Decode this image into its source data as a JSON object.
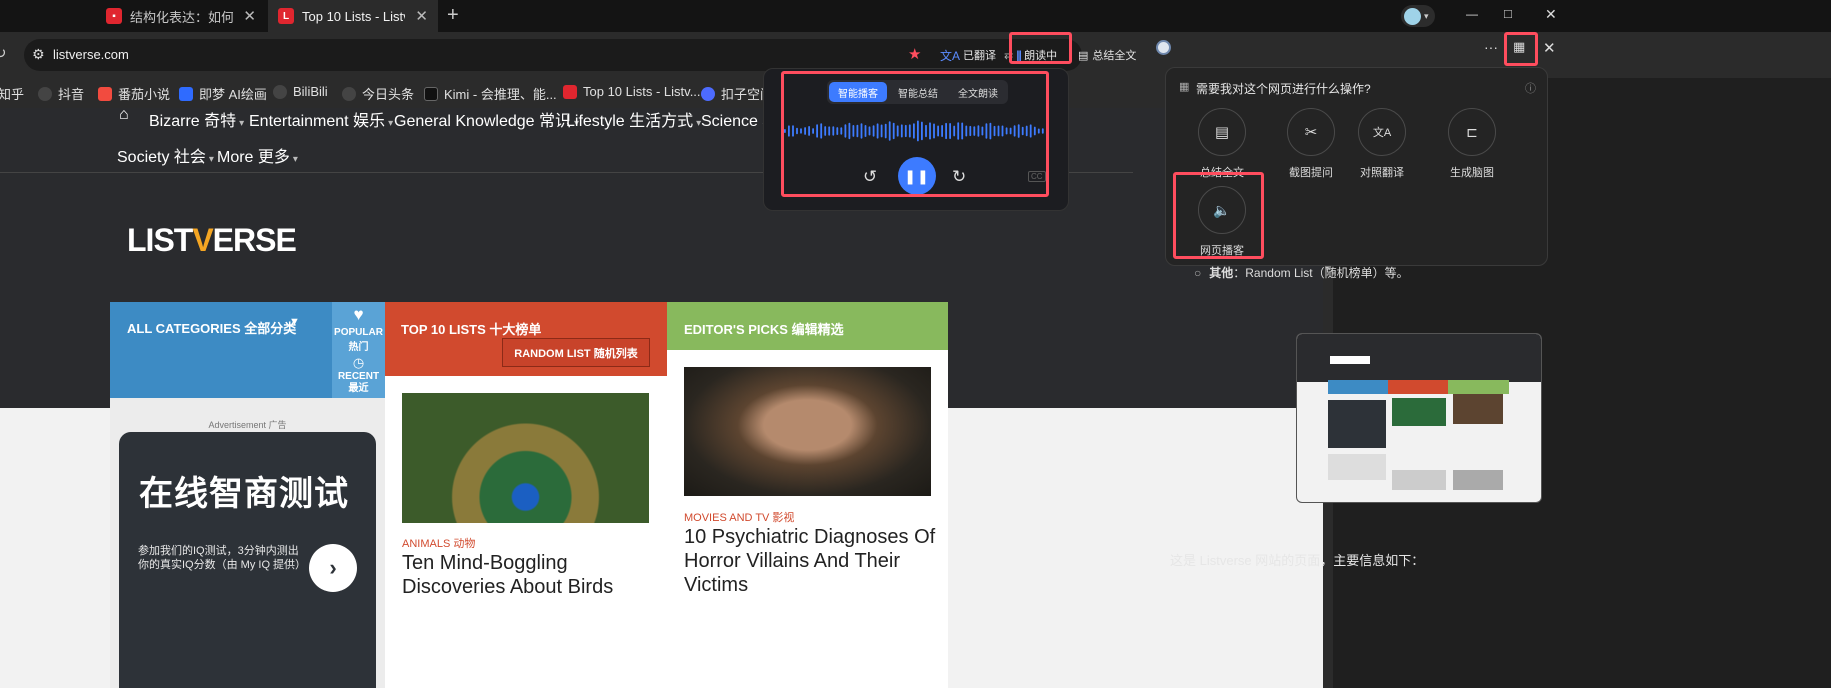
{
  "tabs": [
    {
      "title": "结构化表达：如何汇报工作",
      "active": false,
      "favicon_color": "#e0262f"
    },
    {
      "title": "Top 10 Lists - Listverse",
      "active": true,
      "favicon_color": "#e0262f",
      "favicon_letter": "L"
    }
  ],
  "tab_new_label": "+",
  "window": {
    "minimize": "—",
    "maximize": "□",
    "close": "✕"
  },
  "address": {
    "url": "listverse.com"
  },
  "toolbar": {
    "translated": "已翻译",
    "reading": "朗读中",
    "summarize": "总结全文"
  },
  "bookmarks": [
    {
      "label": "知乎",
      "color": "#1772f6"
    },
    {
      "label": "抖音",
      "color": "#555555"
    },
    {
      "label": "番茄小说",
      "color": "#f24b3f"
    },
    {
      "label": "即梦 AI绘画",
      "color": "#2f6bff"
    },
    {
      "label": "BiliBili",
      "color": "#555555"
    },
    {
      "label": "今日头条",
      "color": "#555555"
    },
    {
      "label": "Kimi - 会推理、能...",
      "color": "#111111"
    },
    {
      "label": "Top 10 Lists - Listv...",
      "color": "#e0262f"
    },
    {
      "label": "扣子空间",
      "color": "#4d6bfe"
    }
  ],
  "site": {
    "nav": [
      {
        "label": "Bizarre 奇特"
      },
      {
        "label": "Entertainment 娱乐"
      },
      {
        "label": "General Knowledge 常识"
      },
      {
        "label": "Lifestyle 生活方式"
      },
      {
        "label": "Science 科"
      },
      {
        "label": "Society 社会"
      },
      {
        "label": "More 更多"
      }
    ],
    "logo": {
      "a": "LIST",
      "v": "V",
      "b": "ERSE"
    },
    "categories": {
      "title": "ALL CATEGORIES 全部分类",
      "popular": "POPULAR 热门",
      "recent": "RECENT 最近"
    },
    "top10": {
      "title": "TOP 10 LISTS 十大榜单",
      "random": "RANDOM LIST 随机列表"
    },
    "editors": {
      "title": "EDITOR'S PICKS 编辑精选"
    },
    "ad": {
      "label": "Advertisement 广告",
      "headline": "在线智商测试",
      "body": "参加我们的IQ测试，3分钟内测出你的真实IQ分数（由 My IQ 提供）"
    },
    "articles": [
      {
        "category": "ANIMALS 动物",
        "title": "Ten Mind-Boggling Discoveries About Birds"
      },
      {
        "category": "MOVIES AND TV 影视",
        "title": "10 Psychiatric Diagnoses Of Horror Villains And Their Victims"
      }
    ]
  },
  "player": {
    "tabs": [
      "智能播客",
      "智能总结",
      "全文朗读"
    ],
    "active_tab": 0,
    "wave_color": "#3d7bff",
    "cc_label": "CC"
  },
  "panel": {
    "question": "需要我对这个网页进行什么操作?",
    "actions": [
      {
        "label": "总结全文",
        "icon": "summary-icon"
      },
      {
        "label": "截图提问",
        "icon": "scissors-icon"
      },
      {
        "label": "对照翻译",
        "icon": "translate-icon"
      },
      {
        "label": "生成脑图",
        "icon": "mindmap-icon"
      },
      {
        "label": "网页播客",
        "icon": "speaker-icon"
      }
    ],
    "list_item_bold": "其他",
    "list_item_rest": "：Random List（随机榜单）等。",
    "summary_line": "这是 Listverse 网站的页面，主要信息如下："
  },
  "colors": {
    "accent_red": "#ff4d5e",
    "cat_blue": "#3d8bc4",
    "top10_orange": "#d14a2e",
    "editors_green": "#88b95d",
    "player_accent": "#3d7bff"
  }
}
